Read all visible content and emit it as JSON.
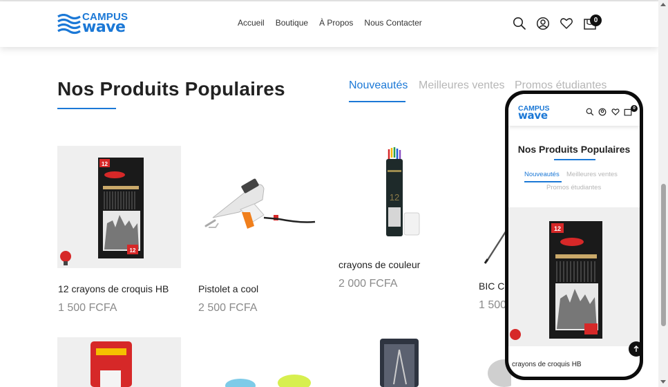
{
  "brand": {
    "line1": "CAMPUS",
    "line2": "wave",
    "color": "#1b78d6"
  },
  "nav": [
    {
      "label": "Accueil"
    },
    {
      "label": "Boutique"
    },
    {
      "label": "À Propos"
    },
    {
      "label": "Nous Contacter"
    }
  ],
  "header_icons": [
    "search-icon",
    "user-icon",
    "heart-icon",
    "cart-icon"
  ],
  "cart": {
    "count": "0"
  },
  "section": {
    "title": "Nos Produits Populaires"
  },
  "tabs": [
    {
      "label": "Nouveautés",
      "active": true
    },
    {
      "label": "Meilleures ventes",
      "active": false
    },
    {
      "label": "Promos étudiantes",
      "active": false
    }
  ],
  "products": [
    {
      "name": "12 crayons de croquis HB",
      "price": "1 500 FCFA",
      "icon": "sketching-pencils-box"
    },
    {
      "name": "Pistolet a cool",
      "price": "2 500 FCFA",
      "icon": "glue-gun"
    },
    {
      "name": "crayons de couleur",
      "price": "2 000 FCFA",
      "icon": "color-pencils-tube"
    },
    {
      "name": "BIC C",
      "price": "1 500",
      "icon": "pen"
    }
  ],
  "mobile": {
    "title": "Nos Produits Populaires",
    "tabs": [
      "Nouveautés",
      "Meilleures ventes",
      "Promos étudiantes"
    ],
    "cart_count": "0",
    "first_product_name": "crayons de croquis HB"
  },
  "colors": {
    "accent": "#1b78d6",
    "price": "#8a8a8a",
    "inactive_tab": "#b6b6b6"
  }
}
